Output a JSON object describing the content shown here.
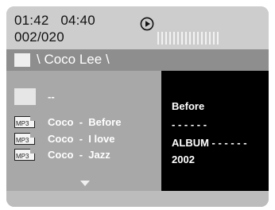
{
  "header": {
    "elapsed_time": "01:42",
    "total_time": "04:40",
    "track_counter": "002/020",
    "play_icon": "play-circle-icon",
    "level_meter_bars": 16
  },
  "folder": {
    "icon": "folder-icon",
    "path": "\\ Coco Lee \\"
  },
  "list": {
    "parent": {
      "icon": "folder-icon",
      "label": "--"
    },
    "files": [
      {
        "icon_text": "MP3",
        "label": "Coco  -  Before",
        "selected": true
      },
      {
        "icon_text": "MP3",
        "label": "Coco  -  I love"
      },
      {
        "icon_text": "MP3",
        "label": "Coco  -  Jazz"
      }
    ],
    "more_icon": "triangle-down-icon"
  },
  "info": {
    "title": "Before",
    "artist": "- - - - - -",
    "album": "ALBUM - - - - - -",
    "year": "2002"
  },
  "colors": {
    "panel": "#b1b1b1",
    "header": "#cdcdcd",
    "folder_bar": "#8e8e8e",
    "list_pane": "#a8a8a8",
    "info_pane": "#000000",
    "text_light": "#ffffff"
  }
}
